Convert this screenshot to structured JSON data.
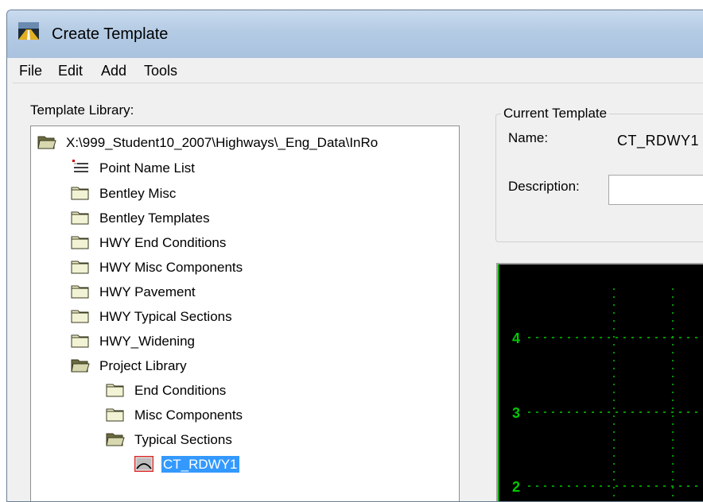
{
  "window": {
    "title": "Create Template",
    "icon": "road-template-icon"
  },
  "menu": [
    "File",
    "Edit",
    "Add",
    "Tools"
  ],
  "library": {
    "label": "Template Library:",
    "tree": [
      {
        "label": "X:\\999_Student10_2007\\Highways\\_Eng_Data\\InRo",
        "icon": "open-folder-icon"
      },
      {
        "label": "Point Name List",
        "icon": "point-list-icon"
      },
      {
        "label": "Bentley Misc",
        "icon": "folder-icon"
      },
      {
        "label": "Bentley Templates",
        "icon": "folder-icon"
      },
      {
        "label": "HWY End Conditions",
        "icon": "folder-icon"
      },
      {
        "label": "HWY Misc Components",
        "icon": "folder-icon"
      },
      {
        "label": "HWY Pavement",
        "icon": "folder-icon"
      },
      {
        "label": "HWY Typical Sections",
        "icon": "folder-icon"
      },
      {
        "label": "HWY_Widening",
        "icon": "folder-icon"
      },
      {
        "label": "Project Library",
        "icon": "open-folder-icon"
      },
      {
        "label": "End Conditions",
        "icon": "folder-icon"
      },
      {
        "label": "Misc Components",
        "icon": "folder-icon"
      },
      {
        "label": "Typical Sections",
        "icon": "open-folder-icon"
      },
      {
        "label": "CT_RDWY1",
        "icon": "template-icon",
        "selected": true
      }
    ]
  },
  "current_template": {
    "group_label": "Current Template",
    "name_label": "Name:",
    "name_value": "CT_RDWY1",
    "description_label": "Description:",
    "description_value": ""
  },
  "viewer": {
    "y_labels": [
      "4",
      "3",
      "2"
    ],
    "grid_color": "#00c800",
    "background": "#000000"
  }
}
